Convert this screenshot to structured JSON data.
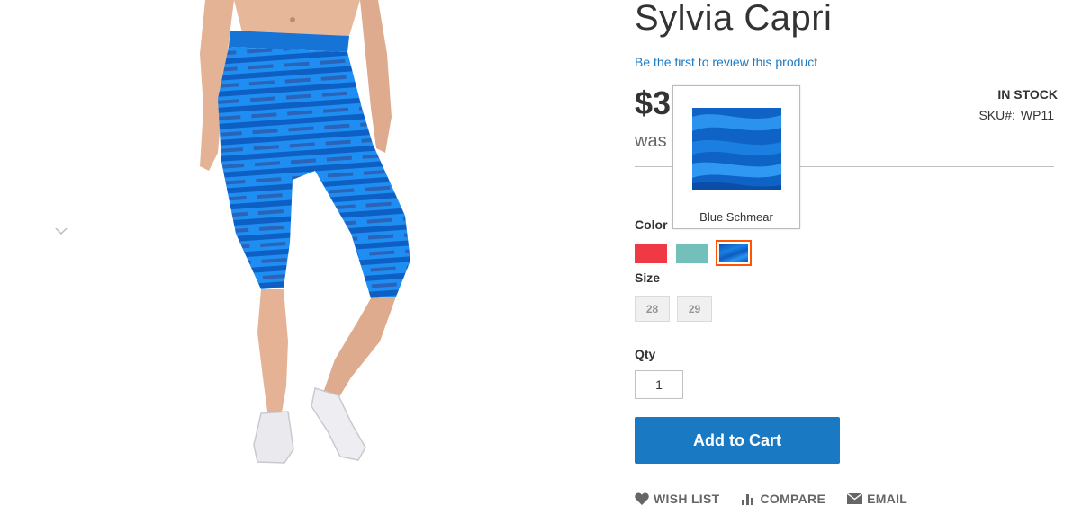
{
  "product": {
    "title": "Sylvia Capri",
    "review_link": "Be the first to review this product",
    "price": "$3",
    "old_price_prefix": "was",
    "stock_status": "IN STOCK",
    "sku_label": "SKU#:",
    "sku_value": "WP11",
    "image_icon": "product-photo-capri-pants"
  },
  "options": {
    "color_label": "Color",
    "colors": [
      {
        "name": "red",
        "hex": "#ef3a46"
      },
      {
        "name": "teal",
        "hex": "#73c0bb"
      },
      {
        "name": "Blue Schmear",
        "hex": "#1a6fd0",
        "selected": true
      }
    ],
    "size_label": "Size",
    "sizes": [
      "28",
      "29"
    ],
    "qty_label": "Qty",
    "qty_value": "1"
  },
  "tooltip": {
    "title": "Blue Schmear"
  },
  "buttons": {
    "add_to_cart": "Add to Cart"
  },
  "actions": {
    "wish_list": "WISH LIST",
    "compare": "COMPARE",
    "email": "EMAIL"
  },
  "colors": {
    "accent_blue": "#1979c3",
    "selected_border": "#ff5501",
    "divider": "#c1c1c1"
  }
}
